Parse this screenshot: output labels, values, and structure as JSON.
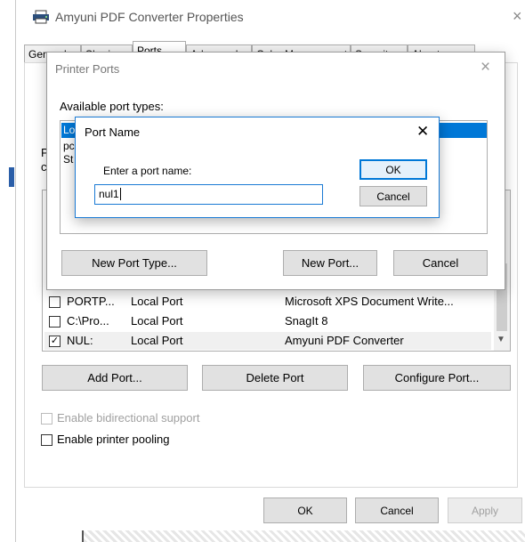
{
  "main_window": {
    "title": "Amyuni PDF Converter Properties",
    "close_symbol": "×",
    "tabs": [
      "General",
      "Sharing",
      "Ports",
      "Advanced",
      "Color Management",
      "Security",
      "About"
    ],
    "side_fragments": [
      "P",
      "c"
    ],
    "ports": [
      {
        "port": "PORTP...",
        "description": "Local Port",
        "printer": "Microsoft XPS Document Write...",
        "checked": false
      },
      {
        "port": "C:\\Pro...",
        "description": "Local Port",
        "printer": "SnagIt 8",
        "checked": false
      },
      {
        "port": "NUL:",
        "description": "Local Port",
        "printer": "Amyuni PDF Converter",
        "checked": true
      }
    ],
    "buttons": {
      "add_port": "Add Port...",
      "delete_port": "Delete Port",
      "configure_port": "Configure Port..."
    },
    "bidirectional_label": "Enable bidirectional support",
    "pooling_label": "Enable printer pooling",
    "footer": {
      "ok": "OK",
      "cancel": "Cancel",
      "apply": "Apply"
    }
  },
  "printer_ports_dialog": {
    "title": "Printer Ports",
    "close_symbol": "×",
    "available_label": "Available port types:",
    "list_fragments": [
      "Lo",
      "pc",
      "St"
    ],
    "buttons": {
      "new_port_type": "New Port Type...",
      "new_port": "New Port...",
      "cancel": "Cancel"
    }
  },
  "port_name_dialog": {
    "title": "Port Name",
    "close_symbol": "✕",
    "prompt": "Enter a port name:",
    "input_value": "nul1",
    "ok": "OK",
    "cancel": "Cancel"
  },
  "colors": {
    "selection": "#0078d7",
    "window_bg": "#ffffff",
    "button_bg": "#e1e1e1"
  }
}
